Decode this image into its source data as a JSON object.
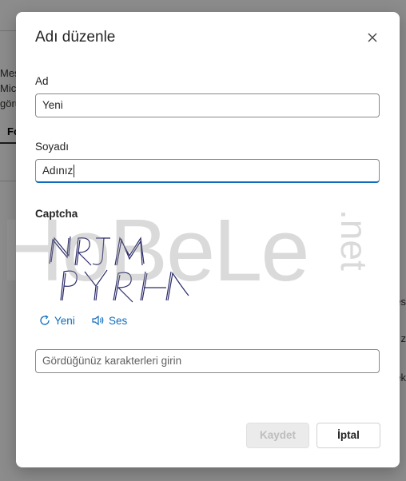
{
  "dialog": {
    "title": "Adı düzenle",
    "first_name": {
      "label": "Ad",
      "value": "Yeni"
    },
    "last_name": {
      "label": "Soyadı",
      "value": "Adınız"
    },
    "captcha": {
      "label": "Captcha",
      "image_text": "NRJM PYRH",
      "refresh_label": "Yeni",
      "audio_label": "Ses",
      "input_placeholder": "Gördüğünüz karakterleri girin"
    },
    "buttons": {
      "save": "Kaydet",
      "cancel": "İptal"
    }
  },
  "background": {
    "left_fragments": [
      "Mesa",
      "Micr",
      "görü"
    ],
    "tab_fragment": "Fo",
    "right_fragments": [
      "es",
      "z",
      "ek"
    ]
  },
  "watermark": {
    "text": "HoBeLe",
    "suffix": ".net"
  },
  "colors": {
    "accent": "#0f6cbd",
    "disabled_button": "#ebebeb"
  },
  "icons": {
    "close": "close-icon",
    "refresh": "refresh-icon",
    "audio": "speaker-icon"
  }
}
